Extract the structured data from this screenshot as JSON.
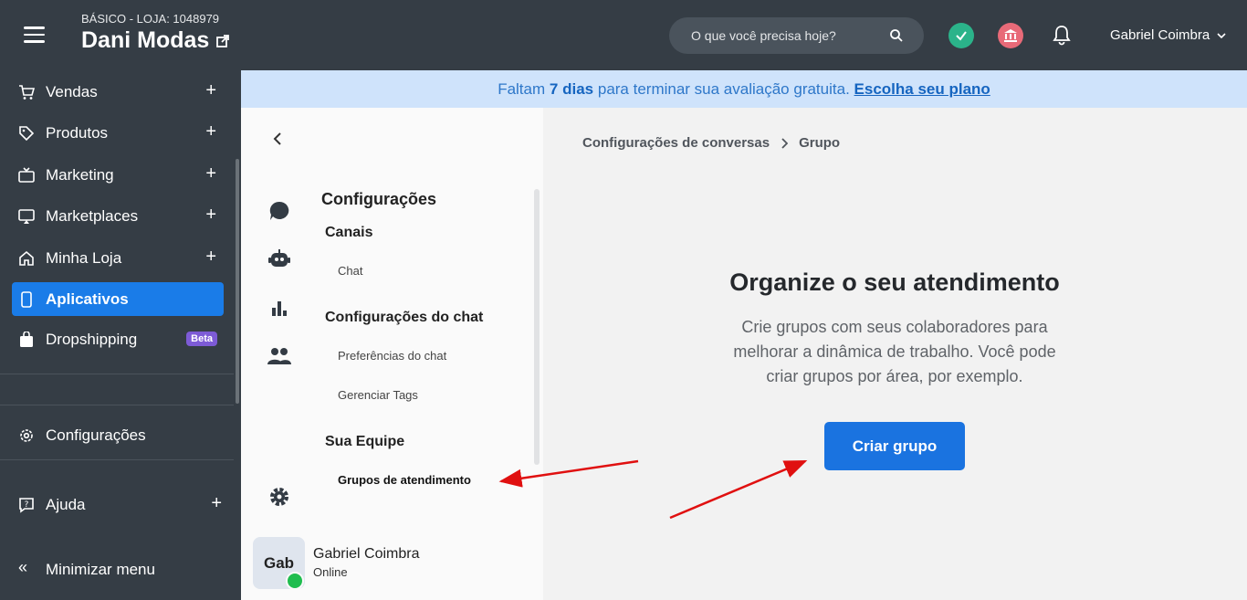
{
  "topbar": {
    "plan_line": "BÁSICO - LOJA: 1048979",
    "store_name": "Dani Modas",
    "search_placeholder": "O que você precisa hoje?",
    "user_name": "Gabriel Coimbra"
  },
  "sidebar": {
    "items": [
      {
        "label": "Vendas",
        "icon": "cart-icon"
      },
      {
        "label": "Produtos",
        "icon": "tag-icon"
      },
      {
        "label": "Marketing",
        "icon": "tv-icon"
      },
      {
        "label": "Marketplaces",
        "icon": "monitor-icon"
      },
      {
        "label": "Minha Loja",
        "icon": "home-icon"
      },
      {
        "label": "Aplicativos",
        "icon": "phone-icon"
      },
      {
        "label": "Dropshipping",
        "icon": "bag-icon",
        "badge": "Beta"
      }
    ],
    "settings_label": "Configurações",
    "help_label": "Ajuda",
    "minimize_label": "Minimizar menu",
    "active_color": "#1a7ce8"
  },
  "banner": {
    "prefix": "Faltam",
    "days": "7",
    "days_word": "dias",
    "middle": "para terminar sua avaliação gratuita.",
    "link": "Escolha seu plano"
  },
  "panel": {
    "title": "Configurações",
    "sections": [
      {
        "title": "Canais",
        "links": [
          "Chat"
        ]
      },
      {
        "title": "Configurações do chat",
        "links": [
          "Preferências do chat",
          "Gerenciar Tags"
        ]
      },
      {
        "title": "Sua Equipe",
        "links": [
          "Grupos de atendimento"
        ]
      }
    ],
    "agent": {
      "initials": "Gab",
      "name": "Gabriel Coimbra",
      "status": "Online"
    }
  },
  "main": {
    "breadcrumb": [
      "Configurações de conversas",
      "Grupo"
    ],
    "heading": "Organize o seu atendimento",
    "description": "Crie grupos com seus colaboradores para melhorar a dinâmica de trabalho. Você pode criar grupos por área, por exemplo.",
    "cta_label": "Criar grupo",
    "cta_color": "#1a73e0",
    "annotation_color": "#e01010"
  }
}
